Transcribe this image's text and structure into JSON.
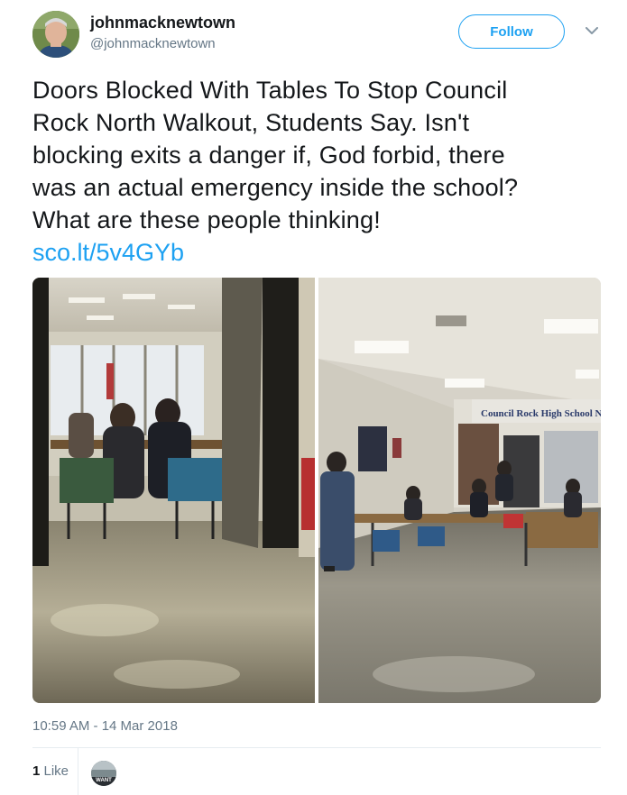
{
  "author": {
    "name": "johnmacknewtown",
    "handle": "@johnmacknewtown"
  },
  "header": {
    "follow_label": "Follow",
    "more_icon": "chevron-down-icon"
  },
  "tweet": {
    "text": "Doors Blocked With Tables To Stop Council\nRock North Walkout, Students Say. Isn't\nblocking exits a danger if, God forbid, there\nwas an actual emergency inside the school?\nWhat are these people thinking!",
    "link": "sco.lt/5v4GYb"
  },
  "photo_right": {
    "sign_text": "Council Rock High School N"
  },
  "footer": {
    "timestamp": "10:59 AM - 14 Mar 2018",
    "like_count": "1",
    "like_label": " Like",
    "liker_avatar_text": "WANT"
  },
  "colors": {
    "accent": "#1da1f2",
    "secondary_text": "#657786"
  }
}
